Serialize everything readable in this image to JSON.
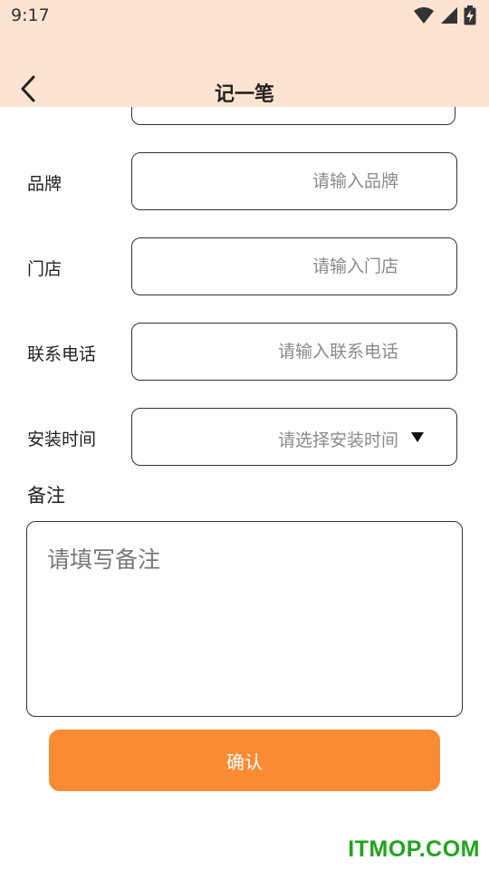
{
  "status_bar": {
    "time": "9:17",
    "icons": [
      "wifi-icon",
      "signal-icon",
      "battery-charging-icon"
    ]
  },
  "header": {
    "title": "记一笔",
    "back_icon": "chevron-left-icon"
  },
  "form": {
    "brand": {
      "label": "品牌",
      "placeholder": "请输入品牌"
    },
    "store": {
      "label": "门店",
      "placeholder": "请输入门店"
    },
    "phone": {
      "label": "联系电话",
      "placeholder": "请输入联系电话"
    },
    "install_time": {
      "label": "安装时间",
      "placeholder": "请选择安装时间",
      "icon": "dropdown-caret-icon"
    },
    "remark": {
      "label": "备注",
      "placeholder": "请填写备注"
    }
  },
  "actions": {
    "confirm_label": "确认"
  },
  "watermark": "ITMOP.COM",
  "colors": {
    "header_bg": "#fde3d1",
    "accent": "#f98b34",
    "watermark": "#1fa51c"
  }
}
